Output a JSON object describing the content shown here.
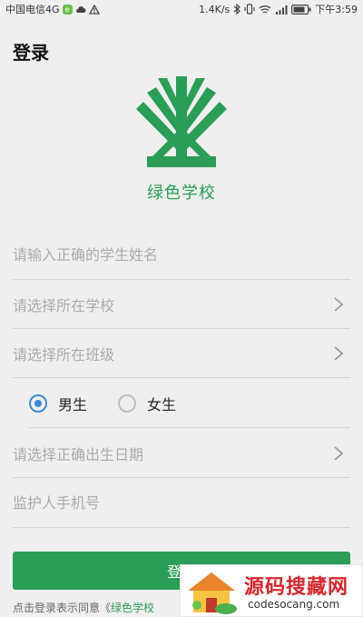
{
  "status_bar": {
    "carrier": "中国电信4G",
    "carrier_badge": "e",
    "speed": "1.4K/s",
    "time": "下午3:59"
  },
  "header": {
    "title": "登录"
  },
  "brand": {
    "name": "绿色学校",
    "color": "#2a9d57"
  },
  "form": {
    "name_placeholder": "请输入正确的学生姓名",
    "school_placeholder": "请选择所在学校",
    "class_placeholder": "请选择所在班级",
    "gender": {
      "options": [
        "男生",
        "女生"
      ],
      "selected": "男生"
    },
    "birthday_placeholder": "请选择正确出生日期",
    "guardian_phone_placeholder": "监护人手机号"
  },
  "login_button": {
    "label": "登录"
  },
  "agreement": {
    "prefix": "点击登录表示同意《",
    "link": "绿色学校"
  },
  "watermark": {
    "title": "源码搜藏网",
    "url": "codesocang.com"
  },
  "colors": {
    "accent": "#2a9d57",
    "radio": "#3b88d6",
    "background": "#efefef"
  }
}
